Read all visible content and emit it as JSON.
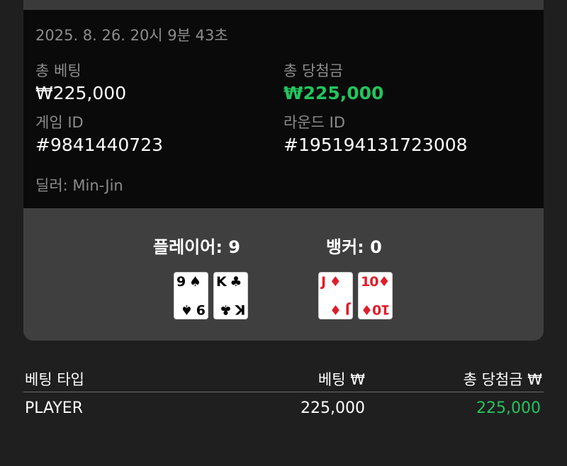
{
  "round": {
    "timestamp": "2025. 8. 26. 20시 9분 43초",
    "total_bet_label": "총 베팅",
    "total_bet_value": "₩225,000",
    "total_win_label": "총 당첨금",
    "total_win_value": "₩225,000",
    "game_id_label": "게임 ID",
    "game_id_value": "#9841440723",
    "round_id_label": "라운드 ID",
    "round_id_value": "#195194131723008",
    "dealer": "딜러: Min-Jin"
  },
  "hands": {
    "player_title": "플레이어: 9",
    "banker_title": "뱅커: 0",
    "player_cards": [
      {
        "rank": "9",
        "suit": "♠",
        "color": "#000000"
      },
      {
        "rank": "K",
        "suit": "♣",
        "color": "#000000"
      }
    ],
    "banker_cards": [
      {
        "rank": "J",
        "suit": "♦",
        "color": "#e11d2a"
      },
      {
        "rank": "10",
        "suit": "♦",
        "color": "#e11d2a"
      }
    ]
  },
  "bets_table": {
    "headers": [
      "베팅 타입",
      "베팅 ₩",
      "총 당첨금 ₩"
    ],
    "rows": [
      {
        "type": "PLAYER",
        "bet": "225,000",
        "win": "225,000"
      }
    ]
  },
  "colors": {
    "win_green": "#22c55e",
    "panel_dark": "#0a0a0a",
    "panel_gray": "#3f3f3f",
    "background": "#1f1f1f"
  }
}
